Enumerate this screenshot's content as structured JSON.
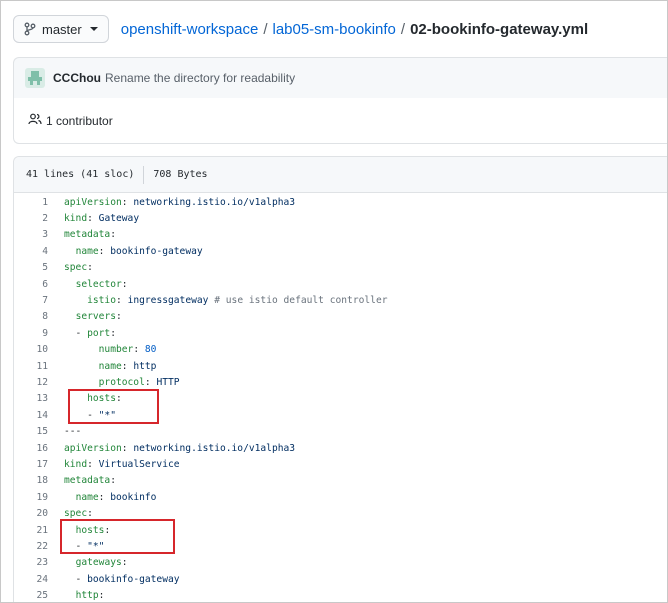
{
  "branch": {
    "label": "master"
  },
  "breadcrumb": {
    "repo": "openshift-workspace",
    "folder": "lab05-sm-bookinfo",
    "file": "02-bookinfo-gateway.yml",
    "separator": "/"
  },
  "commit": {
    "author": "CCChou",
    "message": "Rename the directory for readability"
  },
  "contributors": {
    "label": "1 contributor"
  },
  "file_info": {
    "lines": "41 lines (41 sloc)",
    "size": "708 Bytes"
  },
  "colors": {
    "link": "#0366d6",
    "highlight_box": "#d6262b"
  },
  "code_lines": [
    {
      "num": "1",
      "indent": "",
      "key": "apiVersion",
      "value": "networking.istio.io/v1alpha3",
      "comment": ""
    },
    {
      "num": "2",
      "indent": "",
      "key": "kind",
      "value": "Gateway",
      "comment": ""
    },
    {
      "num": "3",
      "indent": "",
      "key": "metadata",
      "value": "",
      "comment": ""
    },
    {
      "num": "4",
      "indent": "  ",
      "key": "name",
      "value": "bookinfo-gateway",
      "comment": ""
    },
    {
      "num": "5",
      "indent": "",
      "key": "spec",
      "value": "",
      "comment": ""
    },
    {
      "num": "6",
      "indent": "  ",
      "key": "selector",
      "value": "",
      "comment": ""
    },
    {
      "num": "7",
      "indent": "    ",
      "key": "istio",
      "value": "ingressgateway",
      "comment": "# use istio default controller"
    },
    {
      "num": "8",
      "indent": "  ",
      "key": "servers",
      "value": "",
      "comment": ""
    },
    {
      "num": "9",
      "indent": "  - ",
      "key": "port",
      "value": "",
      "comment": ""
    },
    {
      "num": "10",
      "indent": "      ",
      "key": "number",
      "value": "80",
      "comment": ""
    },
    {
      "num": "11",
      "indent": "      ",
      "key": "name",
      "value": "http",
      "comment": ""
    },
    {
      "num": "12",
      "indent": "      ",
      "key": "protocol",
      "value": "HTTP",
      "comment": ""
    },
    {
      "num": "13",
      "indent": "    ",
      "key": "hosts",
      "value": "",
      "comment": ""
    },
    {
      "num": "14",
      "indent": "    - ",
      "key": "",
      "value": "\"*\"",
      "comment": ""
    },
    {
      "num": "15",
      "indent": "",
      "key": "",
      "value": "---",
      "comment": ""
    },
    {
      "num": "16",
      "indent": "",
      "key": "apiVersion",
      "value": "networking.istio.io/v1alpha3",
      "comment": ""
    },
    {
      "num": "17",
      "indent": "",
      "key": "kind",
      "value": "VirtualService",
      "comment": ""
    },
    {
      "num": "18",
      "indent": "",
      "key": "metadata",
      "value": "",
      "comment": ""
    },
    {
      "num": "19",
      "indent": "  ",
      "key": "name",
      "value": "bookinfo",
      "comment": ""
    },
    {
      "num": "20",
      "indent": "",
      "key": "spec",
      "value": "",
      "comment": ""
    },
    {
      "num": "21",
      "indent": "  ",
      "key": "hosts",
      "value": "",
      "comment": ""
    },
    {
      "num": "22",
      "indent": "  - ",
      "key": "",
      "value": "\"*\"",
      "comment": ""
    },
    {
      "num": "23",
      "indent": "  ",
      "key": "gateways",
      "value": "",
      "comment": ""
    },
    {
      "num": "24",
      "indent": "  - ",
      "key": "",
      "value": "bookinfo-gateway",
      "comment": ""
    },
    {
      "num": "25",
      "indent": "  ",
      "key": "http",
      "value": "",
      "comment": ""
    }
  ]
}
